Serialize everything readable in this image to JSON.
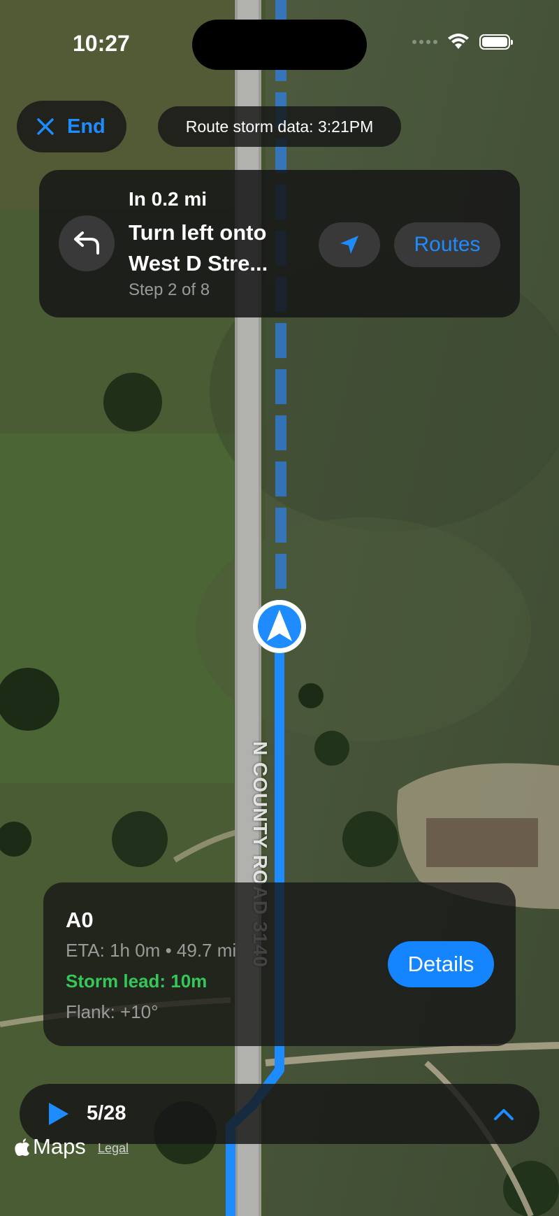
{
  "status_bar": {
    "time": "10:27",
    "icons": [
      "wifi-icon",
      "battery-icon"
    ]
  },
  "top_bar": {
    "end_label": "End",
    "storm_data_label": "Route storm data: 3:21PM"
  },
  "navigation": {
    "distance": "In 0.2 mi",
    "instruction": "Turn left onto West D Stre...",
    "step": "Step 2 of 8",
    "routes_label": "Routes"
  },
  "map": {
    "road_label": "N COUNTY ROAD 3140",
    "route_color": "#1e8bff"
  },
  "route_info": {
    "title": "A0",
    "eta": "ETA: 1h 0m • 49.7 mi",
    "storm_lead": "Storm lead: 10m",
    "flank": "Flank: +10°",
    "details_label": "Details",
    "storm_lead_color": "#35c759"
  },
  "playback": {
    "frame": "5/28"
  },
  "attribution": {
    "logo_text": "Maps",
    "legal": "Legal"
  }
}
